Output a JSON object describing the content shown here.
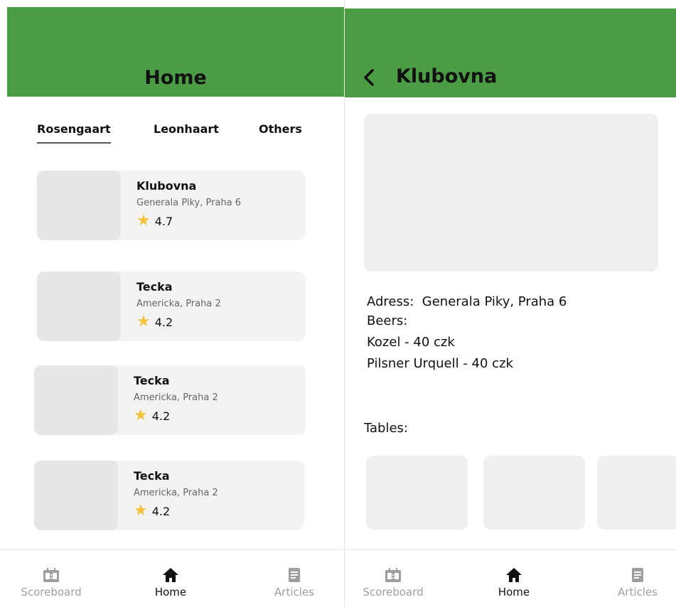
{
  "home": {
    "title": "Home",
    "tabs": [
      {
        "label": "Rosengaart",
        "active": true
      },
      {
        "label": "Leonhaart",
        "active": false
      },
      {
        "label": "Others",
        "active": false
      }
    ],
    "pubs": [
      {
        "name": "Klubovna",
        "address": "Generala Piky, Praha 6",
        "rating": "4.7"
      },
      {
        "name": "Tecka",
        "address": "Americka, Praha 2",
        "rating": "4.2"
      },
      {
        "name": "Tecka",
        "address": "Americka, Praha 2",
        "rating": "4.2"
      },
      {
        "name": "Tecka",
        "address": "Americka, Praha 2",
        "rating": "4.2"
      }
    ]
  },
  "detail": {
    "title": "Klubovna",
    "address_line": "Adress:  Generala Piky, Praha 6",
    "beers_label": "Beers:",
    "beers": [
      "Kozel - 40 czk",
      "Pilsner Urquell - 40 czk"
    ],
    "tables_label": "Tables:"
  },
  "bottom_nav": {
    "items": [
      {
        "label": "Scoreboard",
        "icon": "scoreboard-icon"
      },
      {
        "label": "Home",
        "icon": "home-icon"
      },
      {
        "label": "Articles",
        "icon": "articles-icon"
      }
    ],
    "active": "Home"
  },
  "colors": {
    "app_bar": "#4a9c45",
    "star": "#f3c23a",
    "card_bg": "#f3f3f3",
    "placeholder": "#e6e6e6"
  }
}
